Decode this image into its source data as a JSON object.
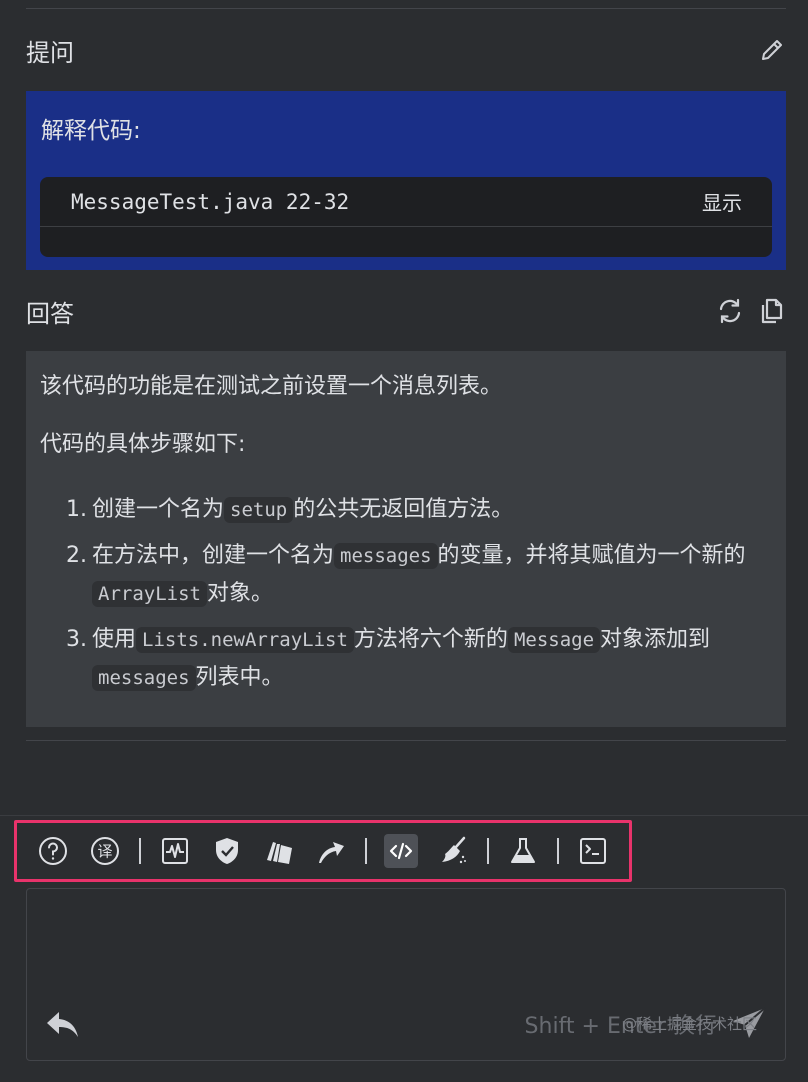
{
  "question": {
    "title": "提问",
    "label": "解释代码:",
    "code_reference": "MessageTest.java 22-32",
    "show_label": "显示"
  },
  "answer": {
    "title": "回答",
    "para1": "该代码的功能是在测试之前设置一个消息列表。",
    "para2": "代码的具体步骤如下:",
    "steps": [
      {
        "num": "1.",
        "t1": "创建一个名为",
        "c1": "setup",
        "t2": "的公共无返回值方法。"
      },
      {
        "num": "2.",
        "t1": "在方法中，创建一个名为",
        "c1": "messages",
        "t2": "的变量，并将其赋值为一个新的",
        "c2": "ArrayList",
        "t3": "对象。"
      },
      {
        "num": "3.",
        "t1": "使用",
        "c1": "Lists.newArrayList",
        "t2": "方法将六个新的",
        "c2": "Message",
        "t3": "对象添加到",
        "c3": "messages",
        "t4": "列表中。"
      }
    ]
  },
  "toolbar": {
    "icons": [
      "question-icon",
      "translate-icon",
      "pulse-icon",
      "shield-icon",
      "cards-icon",
      "arrow-icon",
      "code-icon",
      "broom-icon",
      "flask-icon",
      "terminal-icon"
    ],
    "translate_glyph": "译"
  },
  "input": {
    "placeholder": "",
    "hint": "Shift + Enter 换行"
  },
  "watermark": "@稀土掘金技术社区",
  "colors": {
    "background": "#2b2d30",
    "question_bg": "#1a2f87",
    "answer_bg": "#3b3e42",
    "highlight_border": "#e8336b"
  }
}
